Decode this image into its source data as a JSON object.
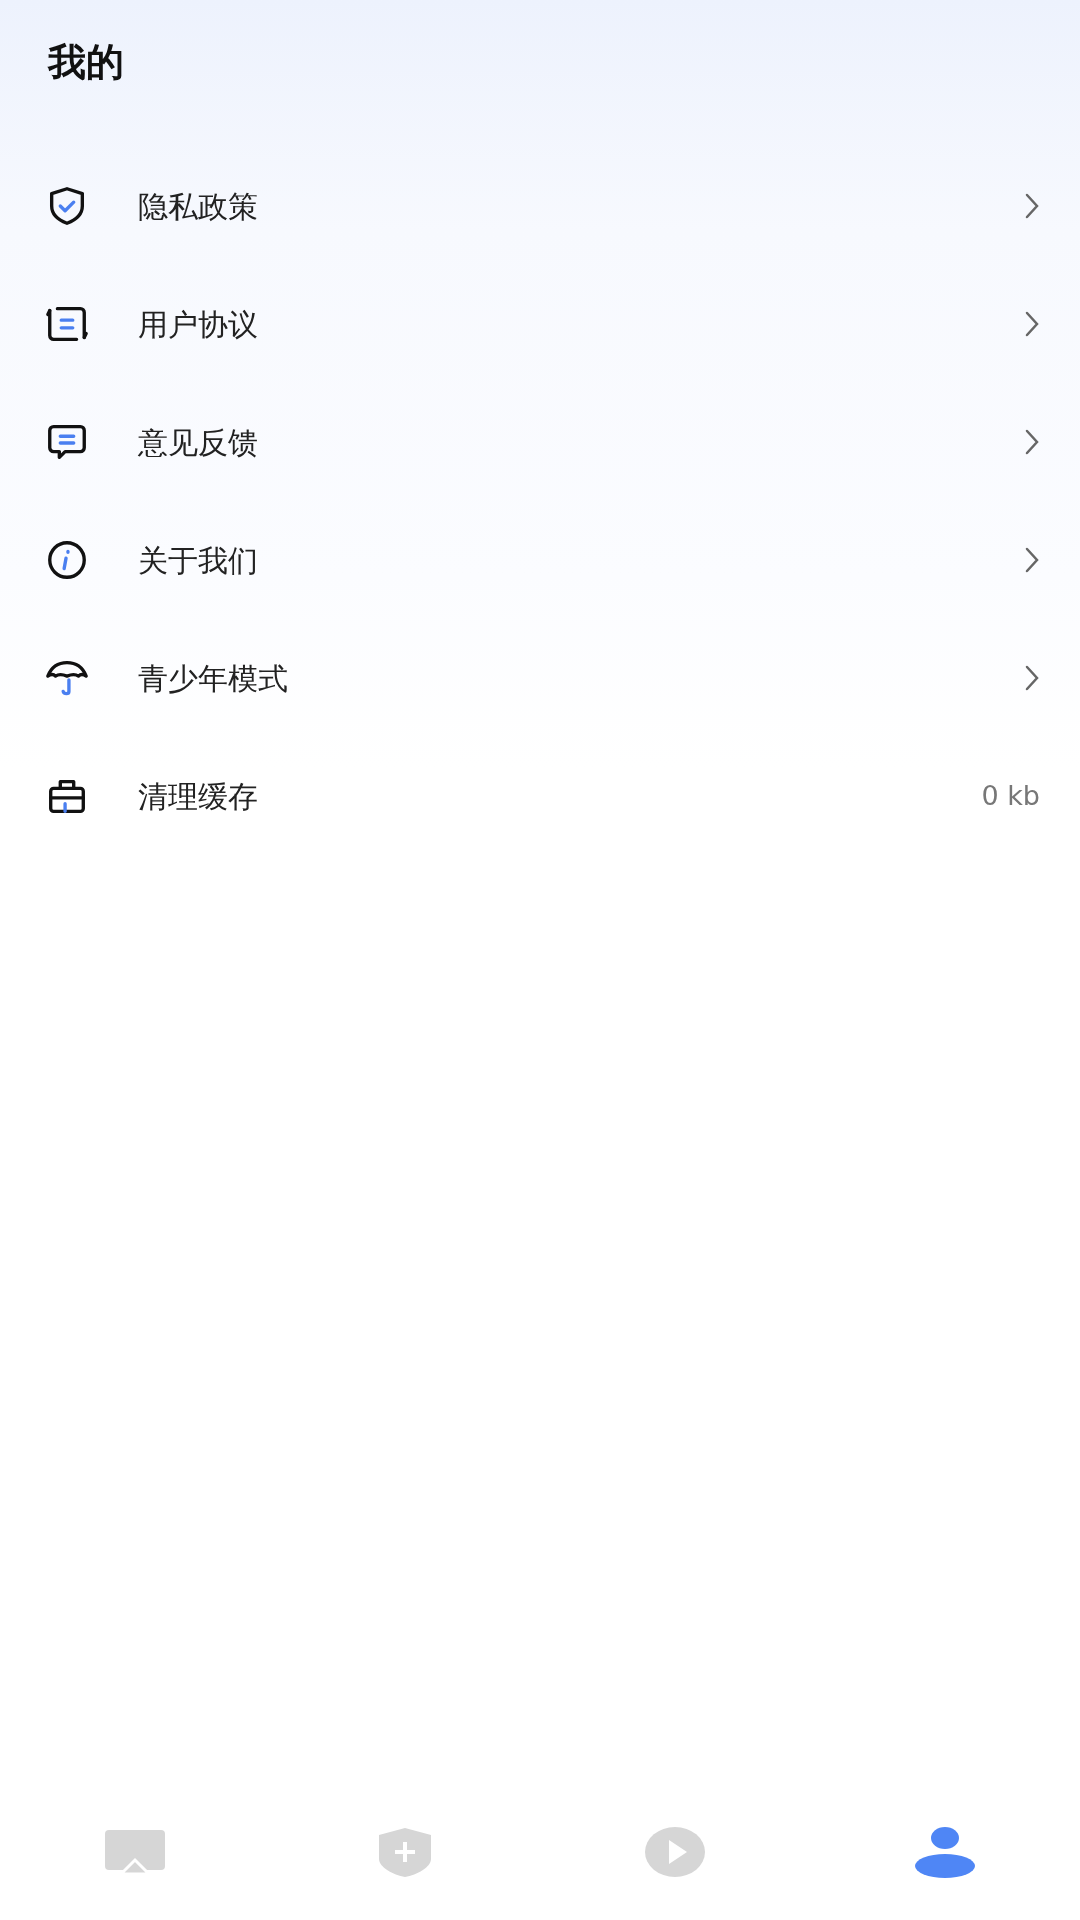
{
  "title": "我的",
  "menu": [
    {
      "kind": "shield",
      "label": "隐私政策"
    },
    {
      "kind": "agreement",
      "label": "用户协议"
    },
    {
      "kind": "chat",
      "label": "意见反馈"
    },
    {
      "kind": "info",
      "label": "关于我们"
    },
    {
      "kind": "umbrella",
      "label": "青少年模式"
    },
    {
      "kind": "toolbox",
      "label": "清理缓存",
      "value": "0 kb"
    }
  ],
  "tabs": [
    {
      "kind": "cast",
      "selected": false
    },
    {
      "kind": "shield",
      "selected": false
    },
    {
      "kind": "play",
      "selected": false
    },
    {
      "kind": "person",
      "selected": true
    }
  ]
}
